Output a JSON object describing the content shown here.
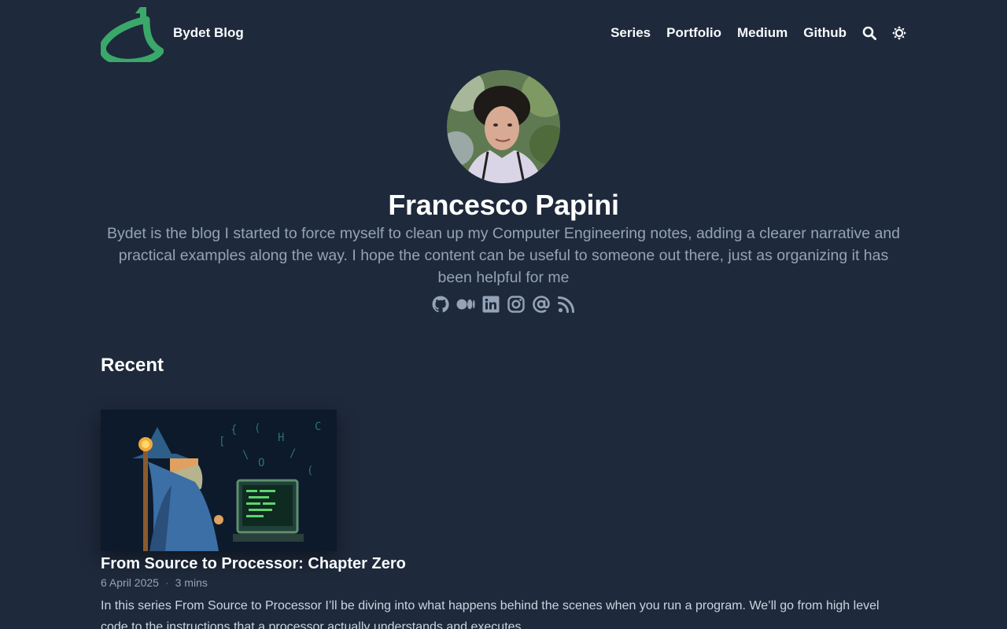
{
  "site": {
    "title": "Bydet Blog"
  },
  "nav": {
    "items": [
      {
        "label": "Series"
      },
      {
        "label": "Portfolio"
      },
      {
        "label": "Medium"
      },
      {
        "label": "Github"
      }
    ],
    "search_icon": "search-icon",
    "theme_icon": "sun-icon"
  },
  "profile": {
    "name": "Francesco Papini",
    "bio": "Bydet is the blog I started to force myself to clean up my Computer Engineering notes, adding a clearer narrative and practical examples along the way. I hope the content can be useful to someone out there, just as organizing it has been helpful for me",
    "socials": [
      "github-icon",
      "medium-icon",
      "linkedin-icon",
      "instagram-icon",
      "email-icon",
      "rss-icon"
    ]
  },
  "recent": {
    "heading": "Recent",
    "posts": [
      {
        "title": "From Source to Processor: Chapter Zero",
        "date": "6 April 2025",
        "separator": "·",
        "reading_time": "3 mins",
        "summary": "In this series From Source to Processor I’ll be diving into what happens behind the scenes when you run a program. We’ll go from high level code to the instructions that a processor actually understands and executes"
      }
    ]
  },
  "colors": {
    "background": "#1e293b",
    "accent": "#3aa86a",
    "muted_text": "#94a3b8"
  }
}
